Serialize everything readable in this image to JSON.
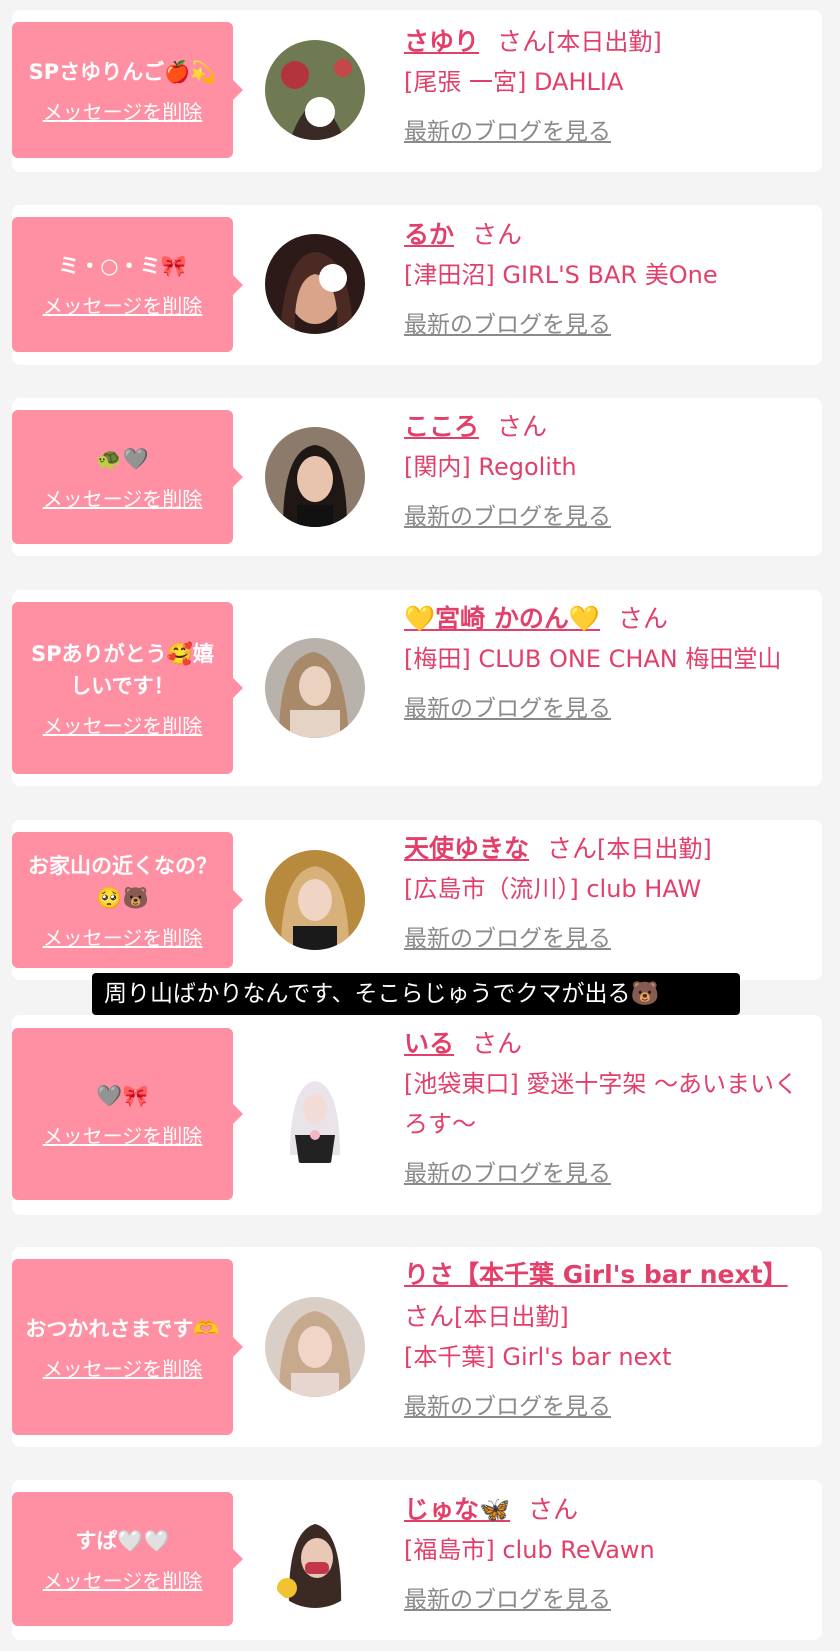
{
  "delete_label": "メッセージを削除",
  "san_label": "さん",
  "blog_label": "最新のブログを見る",
  "caption": "周り山ばかりなんです、そこらじゅうでクマが出る🐻",
  "cards": [
    {
      "message": "SPさゆりんご🍎💫",
      "name": "さゆり",
      "shift": "[本日出勤]",
      "store": "[尾張 一宮] DAHLIA"
    },
    {
      "message": "ミ・○・ミ🎀",
      "name": "るか",
      "shift": "",
      "store": "[津田沼] GIRL'S BAR 美One"
    },
    {
      "message": "🐢🩶",
      "name": "こころ",
      "shift": "",
      "store": "[関内] Regolith"
    },
    {
      "message": "SPありがとう🥰嬉しいです！",
      "name": "💛宮崎 かのん💛",
      "shift": "",
      "store": "[梅田] CLUB ONE CHAN 梅田堂山"
    },
    {
      "message": "お家山の近くなの？🥺🐻",
      "name": "天使ゆきな",
      "shift": "[本日出勤]",
      "store": "[広島市（流川）] club HAW"
    },
    {
      "message": "🩶🎀",
      "name": "いる",
      "shift": "",
      "store": "[池袋東口] 愛迷十字架 〜あいまいくろす〜"
    },
    {
      "message": "おつかれさまです🫶",
      "name": "りさ【本千葉 Girl's bar next】",
      "shift": "[本日出勤]",
      "store": "[本千葉] Girl's bar next"
    },
    {
      "message": "すぱ🤍🤍",
      "name": "じゅな🦋",
      "shift": "",
      "store": "[福島市] club ReVawn"
    }
  ]
}
